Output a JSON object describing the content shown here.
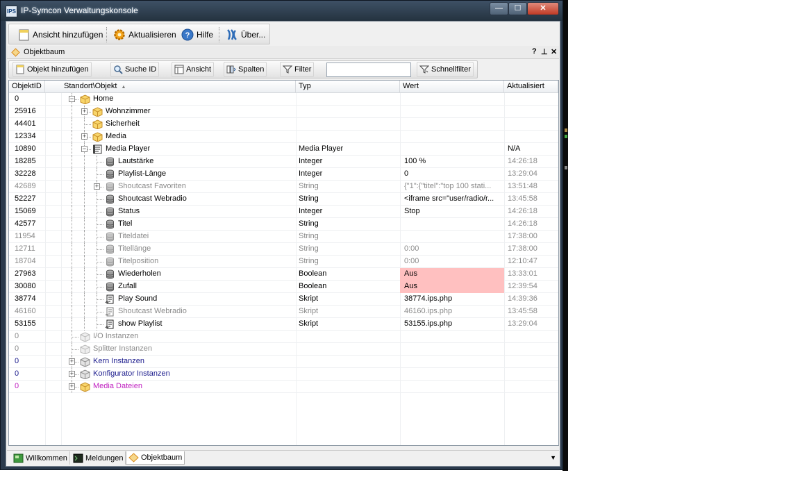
{
  "window": {
    "title": "IP-Symcon Verwaltungskonsole",
    "app_icon_text": "IPS"
  },
  "toolbar": {
    "add_view": "Ansicht hinzufügen",
    "refresh": "Aktualisieren",
    "help": "Hilfe",
    "about": "Über..."
  },
  "panel": {
    "title": "Objektbaum",
    "help": "?",
    "pin": "⊥",
    "close": "✕"
  },
  "tree_toolbar": {
    "add_object": "Objekt hinzufügen",
    "search_id": "Suche ID",
    "view": "Ansicht",
    "columns": "Spalten",
    "filter": "Filter",
    "search_value": "",
    "quickfilter": "Schnellfilter"
  },
  "columns": [
    "ObjektID",
    "Standort\\Objekt",
    "Typ",
    "Wert",
    "Aktualisiert"
  ],
  "rows": [
    {
      "id": "0",
      "name": "Home",
      "typ": "",
      "wert": "",
      "akt": ""
    },
    {
      "id": "25916",
      "name": "Wohnzimmer",
      "typ": "",
      "wert": "",
      "akt": ""
    },
    {
      "id": "44401",
      "name": "Sicherheit",
      "typ": "",
      "wert": "",
      "akt": ""
    },
    {
      "id": "12334",
      "name": "Media",
      "typ": "",
      "wert": "",
      "akt": ""
    },
    {
      "id": "10890",
      "name": "Media Player",
      "typ": "Media Player",
      "wert": "",
      "akt": "N/A"
    },
    {
      "id": "18285",
      "name": "Lautstärke",
      "typ": "Integer",
      "wert": "100 %",
      "akt": "14:26:18"
    },
    {
      "id": "32228",
      "name": "Playlist-Länge",
      "typ": "Integer",
      "wert": "0",
      "akt": "13:29:04"
    },
    {
      "id": "42689",
      "name": "Shoutcast Favoriten",
      "typ": "String",
      "wert": "{\"1\":{\"titel\":\"top 100 stati...",
      "akt": "13:51:48"
    },
    {
      "id": "52227",
      "name": "Shoutcast Webradio",
      "typ": "String",
      "wert": "<iframe src=\"user/radio/r...",
      "akt": "13:45:58"
    },
    {
      "id": "15069",
      "name": "Status",
      "typ": "Integer",
      "wert": "Stop",
      "akt": "14:26:18"
    },
    {
      "id": "42577",
      "name": "Titel",
      "typ": "String",
      "wert": "",
      "akt": "14:26:18"
    },
    {
      "id": "11954",
      "name": "Titeldatei",
      "typ": "String",
      "wert": "",
      "akt": "17:38:00"
    },
    {
      "id": "12711",
      "name": "Titellänge",
      "typ": "String",
      "wert": "0:00",
      "akt": "17:38:00"
    },
    {
      "id": "18704",
      "name": "Titelposition",
      "typ": "String",
      "wert": "0:00",
      "akt": "12:10:47"
    },
    {
      "id": "27963",
      "name": "Wiederholen",
      "typ": "Boolean",
      "wert": "Aus",
      "akt": "13:33:01"
    },
    {
      "id": "30080",
      "name": "Zufall",
      "typ": "Boolean",
      "wert": "Aus",
      "akt": "12:39:54"
    },
    {
      "id": "38774",
      "name": "Play Sound",
      "typ": "Skript",
      "wert": "38774.ips.php",
      "akt": "14:39:36"
    },
    {
      "id": "46160",
      "name": "Shoutcast Webradio",
      "typ": "Skript",
      "wert": "46160.ips.php",
      "akt": "13:45:58"
    },
    {
      "id": "53155",
      "name": "show Playlist",
      "typ": "Skript",
      "wert": "53155.ips.php",
      "akt": "13:29:04"
    },
    {
      "id": "0",
      "name": "I/O Instanzen",
      "typ": "",
      "wert": "",
      "akt": ""
    },
    {
      "id": "0",
      "name": "Splitter Instanzen",
      "typ": "",
      "wert": "",
      "akt": ""
    },
    {
      "id": "0",
      "name": "Kern Instanzen",
      "typ": "",
      "wert": "",
      "akt": ""
    },
    {
      "id": "0",
      "name": "Konfigurator Instanzen",
      "typ": "",
      "wert": "",
      "akt": ""
    },
    {
      "id": "0",
      "name": "Media Dateien",
      "typ": "",
      "wert": "",
      "akt": ""
    }
  ],
  "tabs": {
    "welcome": "Willkommen",
    "messages": "Meldungen",
    "tree": "Objektbaum"
  },
  "colors": {
    "highlight": "#ffc0c0",
    "disabled": "#8a8a8a",
    "instance": "#1a1a8c",
    "media": "#c020c0"
  }
}
